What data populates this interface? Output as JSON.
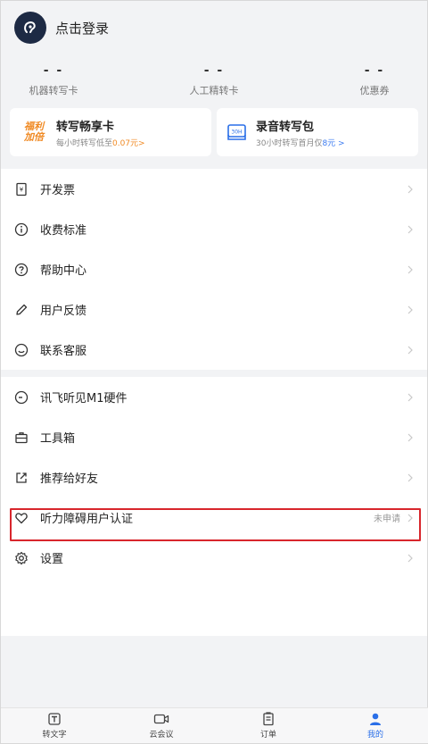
{
  "header": {
    "login_label": "点击登录"
  },
  "stats": [
    {
      "value": "- -",
      "label": "机器转写卡"
    },
    {
      "value": "- -",
      "label": "人工精转卡"
    },
    {
      "value": "- -",
      "label": "优惠券"
    }
  ],
  "cards": {
    "left": {
      "badge_line1": "福利",
      "badge_line2": "加倍",
      "title": "转写畅享卡",
      "sub_prefix": "每小时转写低至",
      "sub_price": "0.07元>"
    },
    "right": {
      "title": "录音转写包",
      "sub_prefix": "30小时转写首月仅",
      "sub_price": "8元 >",
      "icon_text": "30H"
    }
  },
  "menu_group_1": [
    {
      "label": "开发票",
      "icon": "invoice-icon"
    },
    {
      "label": "收费标准",
      "icon": "info-icon"
    },
    {
      "label": "帮助中心",
      "icon": "help-icon"
    },
    {
      "label": "用户反馈",
      "icon": "pencil-icon"
    },
    {
      "label": "联系客服",
      "icon": "customer-service-icon"
    }
  ],
  "menu_group_2": [
    {
      "label": "讯飞听见M1硬件",
      "icon": "device-icon"
    },
    {
      "label": "工具箱",
      "icon": "toolbox-icon"
    },
    {
      "label": "推荐给好友",
      "icon": "share-icon"
    },
    {
      "label": "听力障碍用户认证",
      "icon": "heart-icon",
      "status": "未申请"
    },
    {
      "label": "设置",
      "icon": "gear-icon"
    }
  ],
  "tabbar": [
    {
      "label": "转文字",
      "icon": "text-icon"
    },
    {
      "label": "云会议",
      "icon": "video-icon"
    },
    {
      "label": "订单",
      "icon": "order-icon"
    },
    {
      "label": "我的",
      "icon": "profile-icon",
      "active": true
    }
  ],
  "colors": {
    "accent": "#2a6fe8",
    "highlight_border": "#d8262c",
    "promo_orange": "#f08a24"
  }
}
